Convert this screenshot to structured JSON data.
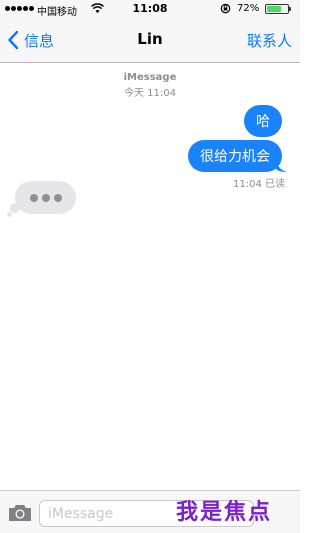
{
  "status_bar": {
    "carrier": "中国移动",
    "time": "11:08",
    "battery_percent": "72%",
    "battery_level": 0.72
  },
  "nav": {
    "back_label": "信息",
    "title": "Lin",
    "contact_label": "联系人"
  },
  "conversation": {
    "service": "iMessage",
    "timestamp": "今天 11:04",
    "messages": [
      {
        "text": "哈"
      },
      {
        "text": "很给力机会"
      }
    ],
    "read_receipt": "11:04 已读"
  },
  "composer": {
    "placeholder": "iMessage"
  },
  "watermark": "我是焦点",
  "colors": {
    "accent": "#0a7aff",
    "bubble_sent": "#1a82fb",
    "bubble_received": "#e5e5ea",
    "watermark": "#7b1fd0"
  }
}
